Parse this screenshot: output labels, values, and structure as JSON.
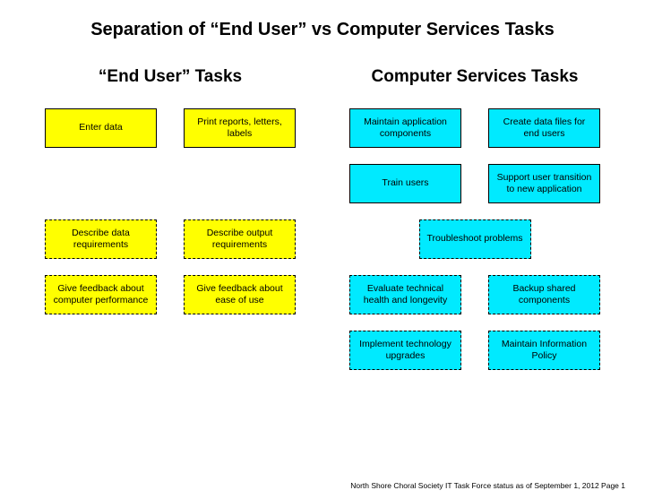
{
  "title": "Separation of “End User” vs Computer Services Tasks",
  "columns": [
    {
      "id": "end-user",
      "heading": "“End User” Tasks",
      "color": "yellow"
    },
    {
      "id": "computer-services",
      "heading": "Computer Services Tasks",
      "color": "cyan"
    }
  ],
  "rows": [
    {
      "left": [
        {
          "text": "Enter data",
          "border": "solid"
        },
        {
          "text": "Print reports, letters, labels",
          "border": "solid"
        }
      ],
      "right": [
        {
          "text": "Maintain application components",
          "border": "solid"
        },
        {
          "text": "Create data files for end users",
          "border": "solid"
        }
      ]
    },
    {
      "left": [],
      "right": [
        {
          "text": "Train users",
          "border": "solid"
        },
        {
          "text": "Support user transition to new application",
          "border": "solid"
        }
      ]
    },
    {
      "left": [
        {
          "text": "Describe data requirements",
          "border": "dashed"
        },
        {
          "text": "Describe output requirements",
          "border": "dashed"
        }
      ],
      "right": [
        {
          "text": "Troubleshoot problems",
          "border": "dashed",
          "wide": true
        }
      ]
    },
    {
      "left": [
        {
          "text": "Give feedback about computer performance",
          "border": "dashed"
        },
        {
          "text": "Give feedback about ease of use",
          "border": "dashed"
        }
      ],
      "right": [
        {
          "text": "Evaluate technical health and longevity",
          "border": "dashed"
        },
        {
          "text": "Backup shared components",
          "border": "dashed"
        }
      ]
    },
    {
      "left": [],
      "right": [
        {
          "text": "Implement technology upgrades",
          "border": "dashed"
        },
        {
          "text": "Maintain Information Policy",
          "border": "dashed"
        }
      ]
    }
  ],
  "footer": "North Shore Choral Society IT Task Force status as of September 1, 2012  Page 1"
}
